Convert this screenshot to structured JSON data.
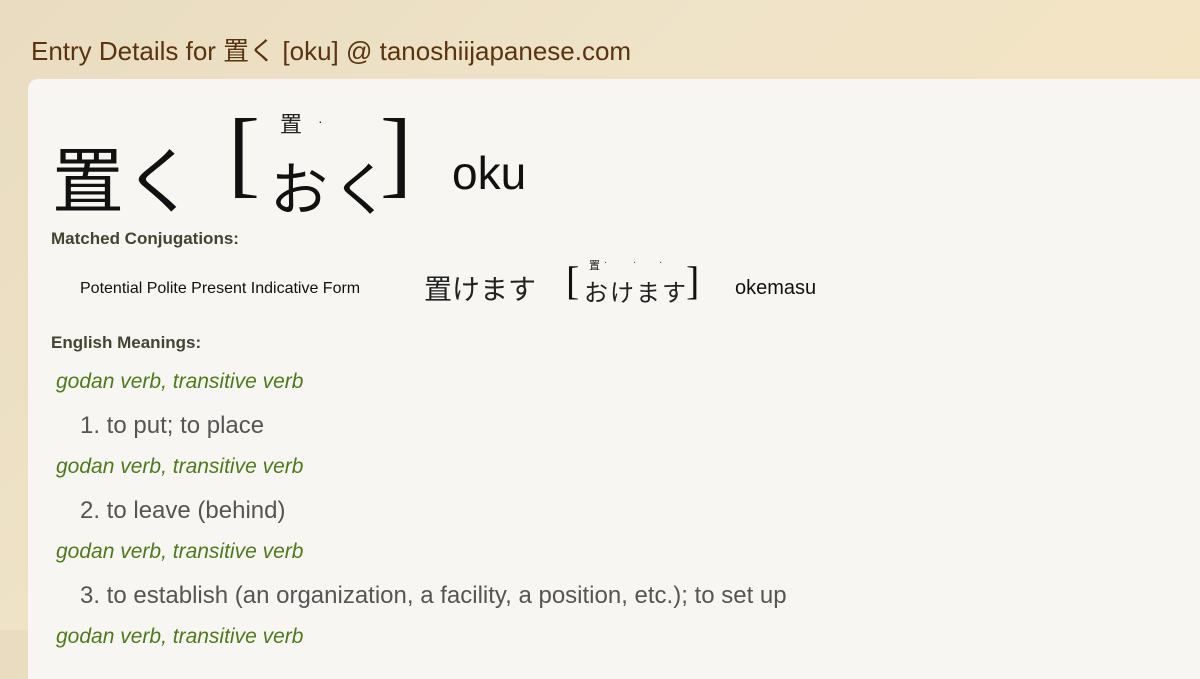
{
  "header": {
    "title": "Entry Details for 置く [oku] @ tanoshiijapanese.com"
  },
  "entry": {
    "word": "置く",
    "reading": "おく",
    "furigana": "置",
    "romaji": "oku",
    "bracket_open": "[",
    "bracket_close": "]",
    "dot": "·"
  },
  "conjugations": {
    "label": "Matched Conjugations:",
    "items": [
      {
        "form": "Potential Polite Present Indicative Form",
        "word": "置けます",
        "reading": "おけます",
        "furigana": "置",
        "romaji": "okemasu"
      }
    ]
  },
  "meanings": {
    "label": "English Meanings:",
    "items": [
      {
        "pos": "godan verb, transitive verb",
        "text": "1. to put; to place"
      },
      {
        "pos": "godan verb, transitive verb",
        "text": "2. to leave (behind)"
      },
      {
        "pos": "godan verb, transitive verb",
        "text": "3. to establish (an organization, a facility, a position, etc.); to set up"
      },
      {
        "pos": "godan verb, transitive verb"
      }
    ]
  }
}
